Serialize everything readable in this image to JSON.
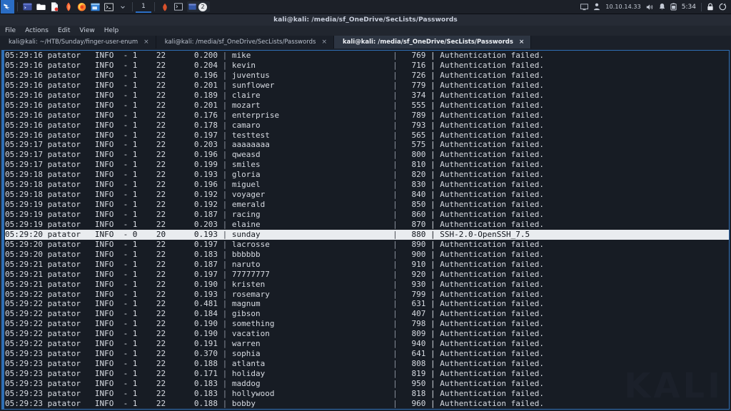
{
  "taskbar": {
    "icons": [
      {
        "name": "kali-menu-icon",
        "glyph": "kali"
      },
      {
        "name": "terminal-icon",
        "glyph": "terminal"
      },
      {
        "name": "file-manager-icon",
        "glyph": "folder"
      },
      {
        "name": "text-editor-icon",
        "glyph": "document"
      },
      {
        "name": "burp-suite-icon",
        "glyph": "burp"
      },
      {
        "name": "firefox-icon",
        "glyph": "firefox"
      },
      {
        "name": "terminal2-icon",
        "glyph": "terminal2"
      },
      {
        "name": "terminal-prompt-icon",
        "glyph": "prompt"
      },
      {
        "name": "chevron-down-icon",
        "glyph": "chevron"
      }
    ],
    "workspace": "1",
    "window_buttons": [
      {
        "name": "burp-window-button",
        "glyph": "burp"
      },
      {
        "name": "terminal-window-button",
        "glyph": "prompt"
      }
    ],
    "task_entry": {
      "name": "terminal-task",
      "badge": "2",
      "glyph": "terminal"
    },
    "tray": {
      "display_icon": "display-icon",
      "vpn_icon": "vpn-icon",
      "ip_address": "10.10.14.33",
      "volume_icon": "volume-icon",
      "notification_icon": "bell-icon",
      "battery_icon": "battery-icon",
      "clock": "5:34",
      "lock_icon": "lock-icon",
      "power_icon": "power-icon"
    }
  },
  "window": {
    "title": "kali@kali: /media/sf_OneDrive/SecLists/Passwords",
    "menu": [
      "File",
      "Actions",
      "Edit",
      "View",
      "Help"
    ],
    "tabs": [
      {
        "label": "kali@kali: ~/HTB/Sunday/finger-user-enum",
        "close": "×",
        "active": false
      },
      {
        "label": "kali@kali: /media/sf_OneDrive/SecLists/Passwords",
        "close": "×",
        "active": false
      },
      {
        "label": "kali@kali: /media/sf_OneDrive/SecLists/Passwords",
        "close": "×",
        "active": true
      }
    ],
    "watermark": "KALI"
  },
  "terminal": {
    "tool": "patator",
    "fail_message": "Authentication failed.",
    "success_message": "SSH-2.0-OpenSSH_7.5",
    "lines": [
      {
        "time": "05:29:16",
        "level": "INFO",
        "code": "1",
        "size": "22",
        "rtt": "0.200",
        "candidate": "mike",
        "num": "769",
        "mesg": "Authentication failed.",
        "hit": false
      },
      {
        "time": "05:29:16",
        "level": "INFO",
        "code": "1",
        "size": "22",
        "rtt": "0.204",
        "candidate": "kevin",
        "num": "716",
        "mesg": "Authentication failed.",
        "hit": false
      },
      {
        "time": "05:29:16",
        "level": "INFO",
        "code": "1",
        "size": "22",
        "rtt": "0.196",
        "candidate": "juventus",
        "num": "726",
        "mesg": "Authentication failed.",
        "hit": false
      },
      {
        "time": "05:29:16",
        "level": "INFO",
        "code": "1",
        "size": "22",
        "rtt": "0.201",
        "candidate": "sunflower",
        "num": "779",
        "mesg": "Authentication failed.",
        "hit": false
      },
      {
        "time": "05:29:16",
        "level": "INFO",
        "code": "1",
        "size": "22",
        "rtt": "0.189",
        "candidate": "claire",
        "num": "374",
        "mesg": "Authentication failed.",
        "hit": false
      },
      {
        "time": "05:29:16",
        "level": "INFO",
        "code": "1",
        "size": "22",
        "rtt": "0.201",
        "candidate": "mozart",
        "num": "555",
        "mesg": "Authentication failed.",
        "hit": false
      },
      {
        "time": "05:29:16",
        "level": "INFO",
        "code": "1",
        "size": "22",
        "rtt": "0.176",
        "candidate": "enterprise",
        "num": "789",
        "mesg": "Authentication failed.",
        "hit": false
      },
      {
        "time": "05:29:16",
        "level": "INFO",
        "code": "1",
        "size": "22",
        "rtt": "0.178",
        "candidate": "camaro",
        "num": "793",
        "mesg": "Authentication failed.",
        "hit": false
      },
      {
        "time": "05:29:16",
        "level": "INFO",
        "code": "1",
        "size": "22",
        "rtt": "0.197",
        "candidate": "testtest",
        "num": "565",
        "mesg": "Authentication failed.",
        "hit": false
      },
      {
        "time": "05:29:17",
        "level": "INFO",
        "code": "1",
        "size": "22",
        "rtt": "0.203",
        "candidate": "aaaaaaaa",
        "num": "575",
        "mesg": "Authentication failed.",
        "hit": false
      },
      {
        "time": "05:29:17",
        "level": "INFO",
        "code": "1",
        "size": "22",
        "rtt": "0.196",
        "candidate": "qweasd",
        "num": "800",
        "mesg": "Authentication failed.",
        "hit": false
      },
      {
        "time": "05:29:17",
        "level": "INFO",
        "code": "1",
        "size": "22",
        "rtt": "0.199",
        "candidate": "smiles",
        "num": "810",
        "mesg": "Authentication failed.",
        "hit": false
      },
      {
        "time": "05:29:18",
        "level": "INFO",
        "code": "1",
        "size": "22",
        "rtt": "0.193",
        "candidate": "gloria",
        "num": "820",
        "mesg": "Authentication failed.",
        "hit": false
      },
      {
        "time": "05:29:18",
        "level": "INFO",
        "code": "1",
        "size": "22",
        "rtt": "0.196",
        "candidate": "miguel",
        "num": "830",
        "mesg": "Authentication failed.",
        "hit": false
      },
      {
        "time": "05:29:18",
        "level": "INFO",
        "code": "1",
        "size": "22",
        "rtt": "0.192",
        "candidate": "voyager",
        "num": "840",
        "mesg": "Authentication failed.",
        "hit": false
      },
      {
        "time": "05:29:19",
        "level": "INFO",
        "code": "1",
        "size": "22",
        "rtt": "0.192",
        "candidate": "emerald",
        "num": "850",
        "mesg": "Authentication failed.",
        "hit": false
      },
      {
        "time": "05:29:19",
        "level": "INFO",
        "code": "1",
        "size": "22",
        "rtt": "0.187",
        "candidate": "racing",
        "num": "860",
        "mesg": "Authentication failed.",
        "hit": false
      },
      {
        "time": "05:29:19",
        "level": "INFO",
        "code": "1",
        "size": "22",
        "rtt": "0.203",
        "candidate": "elaine",
        "num": "870",
        "mesg": "Authentication failed.",
        "hit": false
      },
      {
        "time": "05:29:20",
        "level": "INFO",
        "code": "0",
        "size": "20",
        "rtt": "0.193",
        "candidate": "sunday",
        "num": "880",
        "mesg": "SSH-2.0-OpenSSH_7.5",
        "hit": true
      },
      {
        "time": "05:29:20",
        "level": "INFO",
        "code": "1",
        "size": "22",
        "rtt": "0.197",
        "candidate": "lacrosse",
        "num": "890",
        "mesg": "Authentication failed.",
        "hit": false
      },
      {
        "time": "05:29:20",
        "level": "INFO",
        "code": "1",
        "size": "22",
        "rtt": "0.183",
        "candidate": "bbbbbb",
        "num": "900",
        "mesg": "Authentication failed.",
        "hit": false
      },
      {
        "time": "05:29:21",
        "level": "INFO",
        "code": "1",
        "size": "22",
        "rtt": "0.187",
        "candidate": "naruto",
        "num": "910",
        "mesg": "Authentication failed.",
        "hit": false
      },
      {
        "time": "05:29:21",
        "level": "INFO",
        "code": "1",
        "size": "22",
        "rtt": "0.197",
        "candidate": "77777777",
        "num": "920",
        "mesg": "Authentication failed.",
        "hit": false
      },
      {
        "time": "05:29:21",
        "level": "INFO",
        "code": "1",
        "size": "22",
        "rtt": "0.190",
        "candidate": "kristen",
        "num": "930",
        "mesg": "Authentication failed.",
        "hit": false
      },
      {
        "time": "05:29:22",
        "level": "INFO",
        "code": "1",
        "size": "22",
        "rtt": "0.193",
        "candidate": "rosemary",
        "num": "799",
        "mesg": "Authentication failed.",
        "hit": false
      },
      {
        "time": "05:29:22",
        "level": "INFO",
        "code": "1",
        "size": "22",
        "rtt": "0.481",
        "candidate": "magnum",
        "num": "631",
        "mesg": "Authentication failed.",
        "hit": false
      },
      {
        "time": "05:29:22",
        "level": "INFO",
        "code": "1",
        "size": "22",
        "rtt": "0.184",
        "candidate": "gibson",
        "num": "407",
        "mesg": "Authentication failed.",
        "hit": false
      },
      {
        "time": "05:29:22",
        "level": "INFO",
        "code": "1",
        "size": "22",
        "rtt": "0.190",
        "candidate": "something",
        "num": "798",
        "mesg": "Authentication failed.",
        "hit": false
      },
      {
        "time": "05:29:22",
        "level": "INFO",
        "code": "1",
        "size": "22",
        "rtt": "0.190",
        "candidate": "vacation",
        "num": "809",
        "mesg": "Authentication failed.",
        "hit": false
      },
      {
        "time": "05:29:22",
        "level": "INFO",
        "code": "1",
        "size": "22",
        "rtt": "0.191",
        "candidate": "warren",
        "num": "940",
        "mesg": "Authentication failed.",
        "hit": false
      },
      {
        "time": "05:29:23",
        "level": "INFO",
        "code": "1",
        "size": "22",
        "rtt": "0.370",
        "candidate": "sophia",
        "num": "641",
        "mesg": "Authentication failed.",
        "hit": false
      },
      {
        "time": "05:29:23",
        "level": "INFO",
        "code": "1",
        "size": "22",
        "rtt": "0.188",
        "candidate": "atlanta",
        "num": "808",
        "mesg": "Authentication failed.",
        "hit": false
      },
      {
        "time": "05:29:23",
        "level": "INFO",
        "code": "1",
        "size": "22",
        "rtt": "0.171",
        "candidate": "holiday",
        "num": "819",
        "mesg": "Authentication failed.",
        "hit": false
      },
      {
        "time": "05:29:23",
        "level": "INFO",
        "code": "1",
        "size": "22",
        "rtt": "0.183",
        "candidate": "maddog",
        "num": "950",
        "mesg": "Authentication failed.",
        "hit": false
      },
      {
        "time": "05:29:23",
        "level": "INFO",
        "code": "1",
        "size": "22",
        "rtt": "0.183",
        "candidate": "hollywood",
        "num": "818",
        "mesg": "Authentication failed.",
        "hit": false
      },
      {
        "time": "05:29:23",
        "level": "INFO",
        "code": "1",
        "size": "22",
        "rtt": "0.188",
        "candidate": "bobby",
        "num": "960",
        "mesg": "Authentication failed.",
        "hit": false
      }
    ]
  }
}
